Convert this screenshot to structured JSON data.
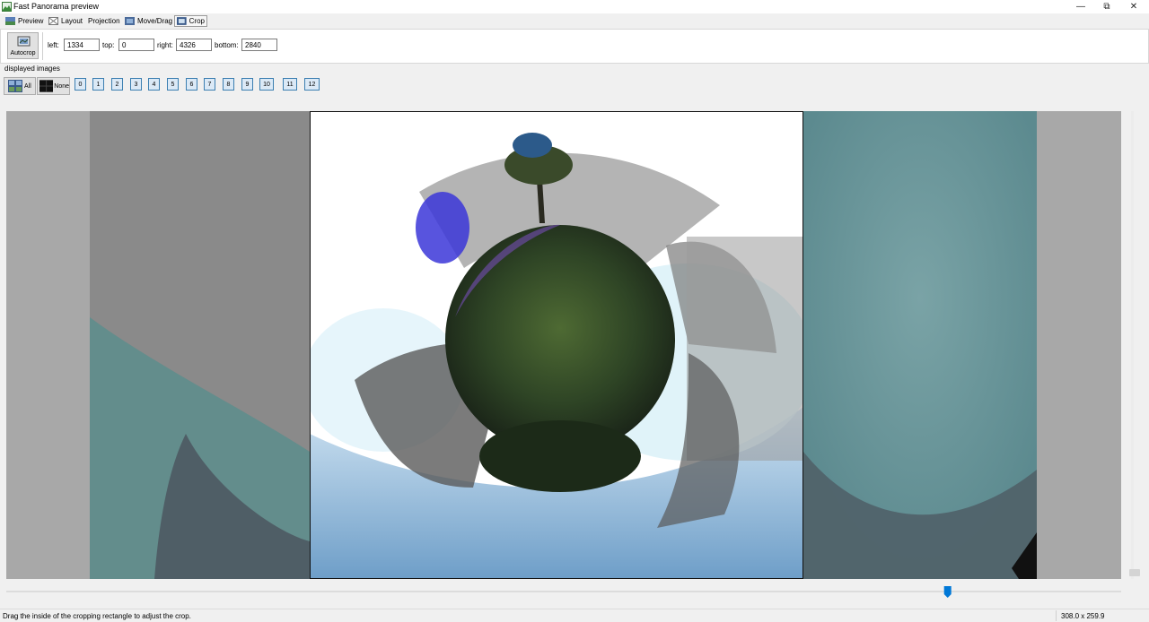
{
  "window": {
    "title": "Fast Panorama preview",
    "minimize_glyph": "—",
    "restore_glyph": "⧉",
    "close_glyph": "✕"
  },
  "tabs": [
    {
      "label": "Preview",
      "icon": "preview-icon",
      "active": false
    },
    {
      "label": "Layout",
      "icon": "layout-icon",
      "active": false
    },
    {
      "label": "Projection",
      "icon": "",
      "active": false
    },
    {
      "label": "Move/Drag",
      "icon": "move-drag-icon",
      "active": false
    },
    {
      "label": "Crop",
      "icon": "crop-icon",
      "active": true
    }
  ],
  "crop": {
    "autocrop_label": "Autocrop",
    "left_label": "left:",
    "left_value": "1334",
    "top_label": "top:",
    "top_value": "0",
    "right_label": "right:",
    "right_value": "4326",
    "bottom_label": "bottom:",
    "bottom_value": "2840"
  },
  "displayed_images": {
    "label": "displayed images",
    "all_label": "All",
    "none_label": "None",
    "images": [
      "0",
      "1",
      "2",
      "3",
      "4",
      "5",
      "6",
      "7",
      "8",
      "9",
      "10",
      "11",
      "12"
    ]
  },
  "hscroll_position": 0.85,
  "status": {
    "message": "Drag the inside of the cropping rectangle to adjust the crop.",
    "size": "308.0 x 259.9"
  },
  "colors": {
    "accent": "#0078d7",
    "image_button_border": "#3c7fb1",
    "image_button_fill": "#dbe9f6",
    "preview_background": "#a9a9a9"
  }
}
